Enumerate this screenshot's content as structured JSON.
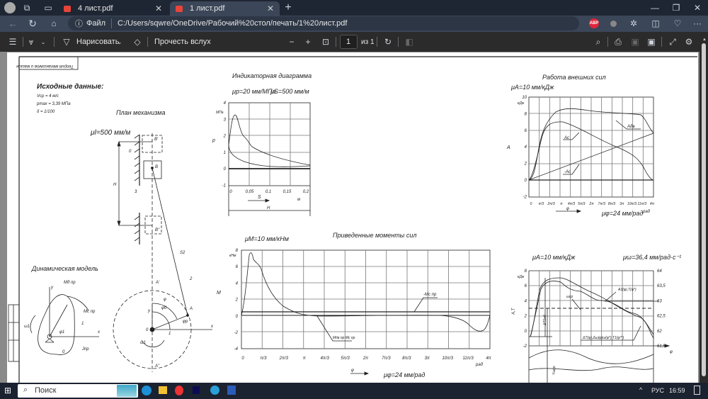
{
  "browser": {
    "tabs": [
      {
        "label": "4 лист.pdf",
        "icon": "pdf-icon"
      },
      {
        "label": "1 лист.pdf",
        "icon": "pdf-icon",
        "active": true
      }
    ],
    "address": {
      "scheme_label": "Файл",
      "url": "C:/Users/sqwre/OneDrive/Рабочий%20стол/печать/1%20лист.pdf"
    },
    "extension_badge": "ABP"
  },
  "pdf_toolbar": {
    "draw_label": "Нарисовать",
    "read_aloud_label": "Прочесть вслух",
    "page_value": "1",
    "page_total": "из 1"
  },
  "drawing": {
    "stamp": "Теория механизмов и машин",
    "initial": {
      "title": "Исходные данные:",
      "v": "Vср = 4 м/с",
      "p": "pmax = 3,39 МПа",
      "delta": "δ = 1/100"
    },
    "mechanism": {
      "title": "План механизма",
      "scale": "μl=500 мм/м",
      "labels": [
        "B'",
        "B",
        "B''",
        "0",
        "3",
        "H",
        "S2",
        "2",
        "A'",
        "A",
        "A''",
        "φ",
        "φ0",
        "φр",
        "1",
        "0",
        "x",
        "y",
        "ω1"
      ]
    },
    "dynamic": {
      "title": "Динамическая модель",
      "labels": [
        "Mд пр",
        "Mс пр",
        "y",
        "x",
        "ω1",
        "1",
        "φ1",
        "0",
        "Jпр"
      ]
    },
    "indicator": {
      "title": "Индикаторная диаграмма",
      "scale_p": "μp=20 мм/МПа",
      "scale_s": "μS=500 мм/м",
      "y_unit": "МПа",
      "y_axis": "p",
      "y_ticks": [
        "4",
        "3",
        "2",
        "1",
        "0",
        "-1"
      ],
      "x_ticks": [
        "0",
        "0,05",
        "0,1",
        "0,15",
        "0,2"
      ],
      "x_unit": "м",
      "s_label": "S",
      "h_label": "H"
    },
    "work": {
      "title": "Работа внешних сил",
      "scale": "μA=10 мм/кДж",
      "y_unit": "кДж",
      "y_axis": "A",
      "y_ticks": [
        "10",
        "8",
        "6",
        "4",
        "2",
        "0",
        "-2"
      ],
      "x_ticks": [
        "0",
        "π/3",
        "2π/3",
        "π",
        "4π/3",
        "5π/3",
        "2π",
        "7π/3",
        "8π/3",
        "3π",
        "10π/3",
        "11π/3",
        "4π"
      ],
      "x_unit": "рад",
      "phi": "φ",
      "scale_phi": "μφ=24 мм/рад",
      "curve_labels": [
        "Aдв",
        "Aс",
        "-Aс"
      ]
    },
    "moments": {
      "title": "Приведенные моменты сил",
      "scale": "μM=10 мм/кНм",
      "y_unit": "кНм",
      "y_axis": "M",
      "y_ticks": [
        "8",
        "6",
        "4",
        "2",
        "0",
        "-2",
        "-4"
      ],
      "x_ticks": [
        "0",
        "π/3",
        "2π/3",
        "π",
        "4π/3",
        "5π/3",
        "2π",
        "7π/3",
        "8π/3",
        "3π",
        "10π/3",
        "11π/3",
        "4π"
      ],
      "x_unit": "рад",
      "phi": "φ",
      "scale_phi": "μφ=24 мм/рад",
      "curve_labels": [
        "-Mс пр",
        "Mдв пр Mс пр"
      ]
    },
    "energy": {
      "scale_a": "μA=10 мм/кДж",
      "scale_w": "μω=36,4 мм/рад·с⁻¹",
      "y_unit": "кДж",
      "y_axis": "A,T",
      "y_ticks": [
        "8",
        "6",
        "4",
        "2",
        "0",
        "-2"
      ],
      "y2_ticks": [
        "64",
        "63,5",
        "63",
        "62,5",
        "62",
        "61,5"
      ],
      "phi": "φ",
      "curve_labels": [
        "ωср",
        "A1(φ),T(φ*)",
        "ΔT(φ),Δω(φ)ω(φ*),T1(φ**)",
        "ΔT1нб",
        "Yωср"
      ]
    }
  },
  "taskbar": {
    "search_placeholder": "Поиск",
    "lang": "РУС",
    "time": "16:59"
  }
}
